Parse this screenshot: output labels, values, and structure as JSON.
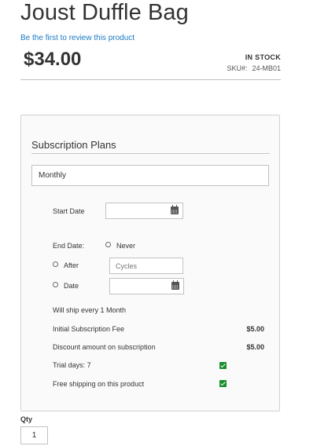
{
  "product": {
    "title": "Joust Duffle Bag",
    "review_link": "Be the first to review this product",
    "price": "$34.00",
    "stock": "IN STOCK",
    "sku_label": "SKU#:",
    "sku_value": "24-MB01"
  },
  "subscription": {
    "heading": "Subscription Plans",
    "plan_selected": "Monthly",
    "start_date_label": "Start Date",
    "start_date_value": "",
    "end_date_label": "End Date:",
    "option_never": "Never",
    "option_after": "After",
    "cycles_placeholder": "Cycles",
    "option_date": "Date",
    "end_date_value": "",
    "ship_text": "Will ship every 1 Month",
    "fee_label": "Initial Subscription Fee",
    "fee_value": "$5.00",
    "discount_label": "Discount amount on subscription",
    "discount_value": "$5.00",
    "trial_label": "Trial days: 7",
    "trial_checked": true,
    "shipping_label": "Free shipping on this product",
    "shipping_checked": true
  },
  "qty": {
    "label": "Qty",
    "value": "1"
  },
  "colors": {
    "link": "#1979c3",
    "check": "#1a8f2d",
    "border": "#c2c2c2"
  },
  "icons": [
    "calendar-icon",
    "checkbox-checked-icon",
    "radio-icon"
  ]
}
